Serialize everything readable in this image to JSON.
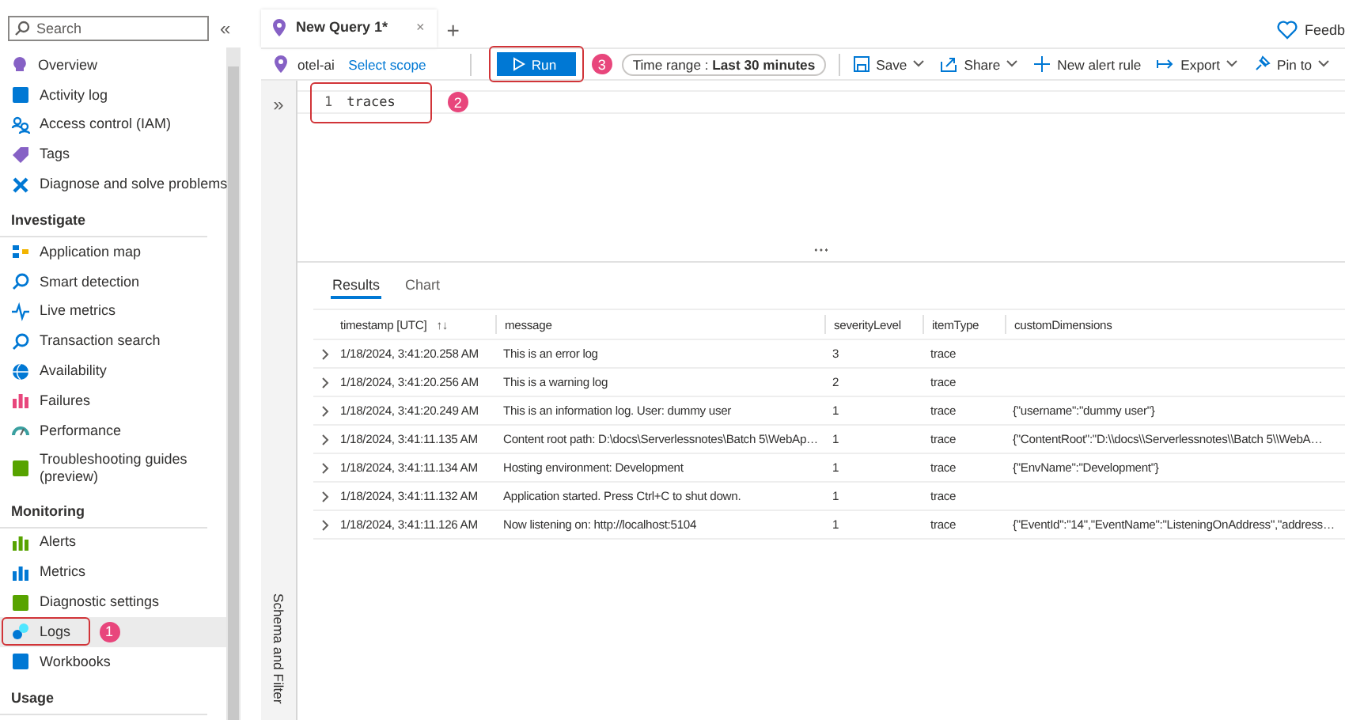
{
  "sidebar": {
    "search": {
      "placeholder": "Search"
    },
    "collapse": "«",
    "sections": [
      {
        "items": [
          {
            "label": "Overview",
            "selected": false
          },
          {
            "label": "Activity log",
            "selected": false
          },
          {
            "label": "Access control (IAM)",
            "selected": false
          },
          {
            "label": "Tags",
            "selected": false
          },
          {
            "label": "Diagnose and solve problems",
            "selected": false
          }
        ]
      },
      {
        "heading": "Investigate",
        "items": [
          {
            "label": "Application map",
            "selected": false
          },
          {
            "label": "Smart detection",
            "selected": false
          },
          {
            "label": "Live metrics",
            "selected": false
          },
          {
            "label": "Transaction search",
            "selected": false
          },
          {
            "label": "Availability",
            "selected": false
          },
          {
            "label": "Failures",
            "selected": false
          },
          {
            "label": "Performance",
            "selected": false
          },
          {
            "label": "Troubleshooting guides (preview)",
            "selected": false
          }
        ]
      },
      {
        "heading": "Monitoring",
        "items": [
          {
            "label": "Alerts",
            "selected": false
          },
          {
            "label": "Metrics",
            "selected": false
          },
          {
            "label": "Diagnostic settings",
            "selected": false
          },
          {
            "label": "Logs",
            "selected": true,
            "callout": "1"
          },
          {
            "label": "Workbooks",
            "selected": false
          }
        ]
      },
      {
        "heading": "Usage"
      }
    ]
  },
  "tabs": [
    {
      "label": "New Query 1*",
      "selected": true,
      "close": "×"
    }
  ],
  "new_tab": "+",
  "feedback": "Feedb",
  "toolbar": {
    "scope": "otel-ai",
    "select_scope": "Select scope",
    "run": {
      "label": "Run",
      "callout": "3"
    },
    "time_range": {
      "label": "Time range :",
      "value": "Last 30 minutes"
    },
    "actions": [
      {
        "label": "Save",
        "dropdown": true
      },
      {
        "label": "Share",
        "dropdown": true
      },
      {
        "label": "New alert rule",
        "dropdown": false
      },
      {
        "label": "Export",
        "dropdown": true
      },
      {
        "label": "Pin to",
        "dropdown": true
      }
    ]
  },
  "side_rail": {
    "expand": "»",
    "label": "Schema and Filter"
  },
  "editor": {
    "lines": [
      {
        "number": "1",
        "code": "traces"
      }
    ],
    "callout": "2"
  },
  "results": {
    "tabs": [
      {
        "label": "Results",
        "selected": true
      },
      {
        "label": "Chart",
        "selected": false
      }
    ],
    "columns": [
      {
        "label": "timestamp [UTC]",
        "sort": "↑↓"
      },
      {
        "label": "message"
      },
      {
        "label": "severityLevel"
      },
      {
        "label": "itemType"
      },
      {
        "label": "customDimensions"
      }
    ],
    "rows": [
      {
        "cells": [
          "1/18/2024, 3:41:20.258 AM",
          "This is an error log",
          "3",
          "trace"
        ]
      },
      {
        "cells": [
          "1/18/2024, 3:41:20.256 AM",
          "This is a warning log",
          "2",
          "trace"
        ]
      },
      {
        "cells": [
          "1/18/2024, 3:41:20.249 AM",
          "This is an information log. User: dummy user",
          "1",
          "trace",
          "{\"username\":\"dummy user\"}"
        ]
      },
      {
        "cells": [
          "1/18/2024, 3:41:11.135 AM",
          "Content root path: D:\\docs\\Serverlessnotes\\Batch 5\\WebAp…",
          "1",
          "trace",
          "{\"ContentRoot\":\"D:\\\\docs\\\\Serverlessnotes\\\\Batch 5\\\\WebA…"
        ]
      },
      {
        "cells": [
          "1/18/2024, 3:41:11.134 AM",
          "Hosting environment: Development",
          "1",
          "trace",
          "{\"EnvName\":\"Development\"}"
        ]
      },
      {
        "cells": [
          "1/18/2024, 3:41:11.132 AM",
          "Application started. Press Ctrl+C to shut down.",
          "1",
          "trace"
        ]
      },
      {
        "cells": [
          "1/18/2024, 3:41:11.126 AM",
          "Now listening on: http://localhost:5104",
          "1",
          "trace",
          "{\"EventId\":\"14\",\"EventName\":\"ListeningOnAddress\",\"address…"
        ]
      }
    ]
  }
}
